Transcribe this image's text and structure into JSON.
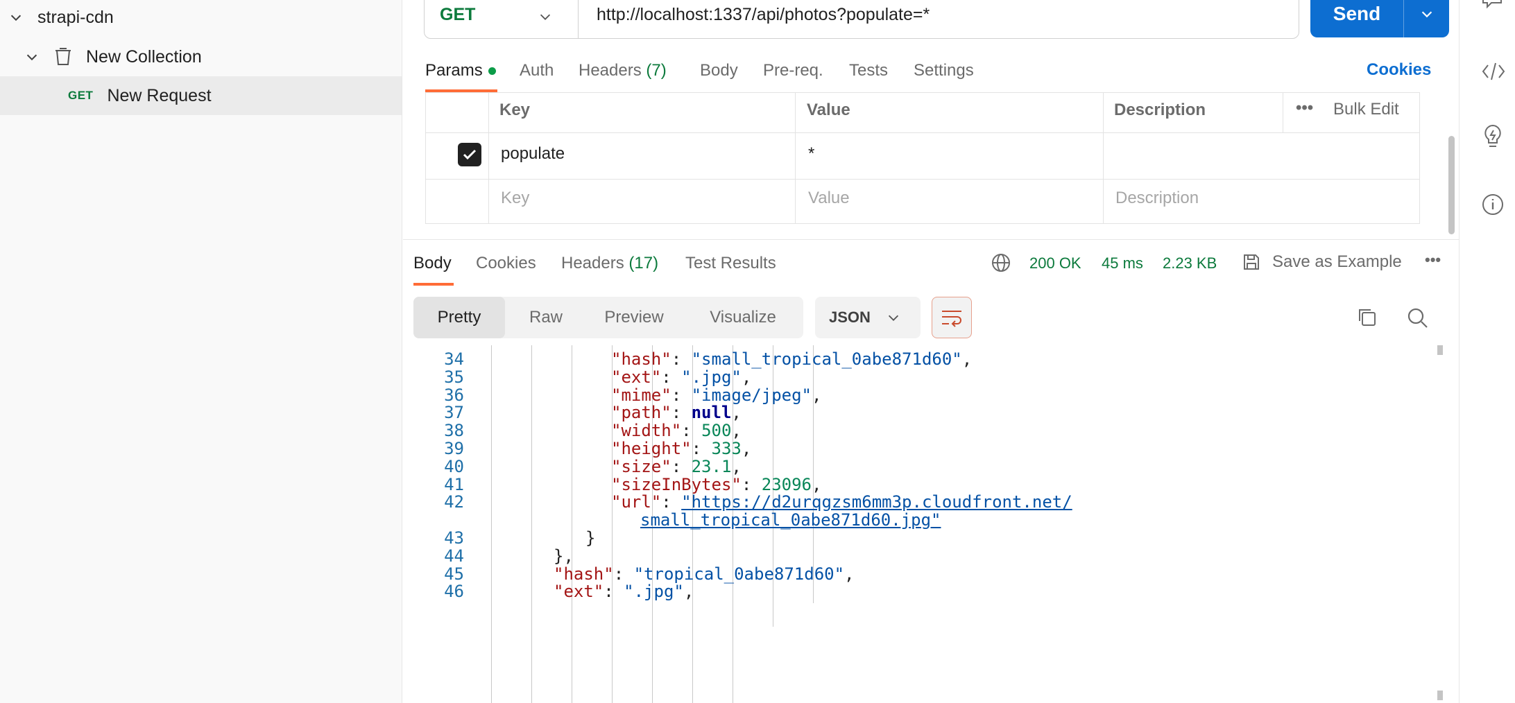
{
  "sidebar": {
    "workspace": "strapi-cdn",
    "collection": "New Collection",
    "request": {
      "method": "GET",
      "name": "New Request"
    }
  },
  "request": {
    "method": "GET",
    "url": "http://localhost:1337/api/photos?populate=*",
    "send_label": "Send"
  },
  "tabs": {
    "params": "Params",
    "auth": "Auth",
    "headers": "Headers",
    "headers_count": "(7)",
    "body": "Body",
    "prereq": "Pre-req.",
    "tests": "Tests",
    "settings": "Settings",
    "cookies": "Cookies"
  },
  "params_table": {
    "col_key": "Key",
    "col_value": "Value",
    "col_description": "Description",
    "bulk_edit": "Bulk Edit",
    "rows": [
      {
        "key": "populate",
        "value": "*",
        "checked": true
      }
    ],
    "placeholder_key": "Key",
    "placeholder_value": "Value",
    "placeholder_description": "Description"
  },
  "response": {
    "tabs": {
      "body": "Body",
      "cookies": "Cookies",
      "headers": "Headers",
      "headers_count": "(17)",
      "test_results": "Test Results"
    },
    "status": "200 OK",
    "time": "45 ms",
    "size": "2.23 KB",
    "save_example": "Save as Example",
    "views": {
      "pretty": "Pretty",
      "raw": "Raw",
      "preview": "Preview",
      "visualize": "Visualize"
    },
    "format": "JSON"
  },
  "code": {
    "line_numbers": [
      "34",
      "35",
      "36",
      "37",
      "38",
      "39",
      "40",
      "41",
      "42",
      "",
      "43",
      "44",
      "45",
      "46"
    ],
    "lines": [
      {
        "key": "\"hash\"",
        "sep": ": ",
        "val": "\"small_tropical_0abe871d60\"",
        "type": "s",
        "end": ","
      },
      {
        "key": "\"ext\"",
        "sep": ": ",
        "val": "\".jpg\"",
        "type": "s",
        "end": ","
      },
      {
        "key": "\"mime\"",
        "sep": ": ",
        "val": "\"image/jpeg\"",
        "type": "s",
        "end": ","
      },
      {
        "key": "\"path\"",
        "sep": ": ",
        "val": "null",
        "type": "b",
        "end": ","
      },
      {
        "key": "\"width\"",
        "sep": ": ",
        "val": "500",
        "type": "n",
        "end": ","
      },
      {
        "key": "\"height\"",
        "sep": ": ",
        "val": "333",
        "type": "n",
        "end": ","
      },
      {
        "key": "\"size\"",
        "sep": ": ",
        "val": "23.1",
        "type": "n",
        "end": ","
      },
      {
        "key": "\"sizeInBytes\"",
        "sep": ": ",
        "val": "23096",
        "type": "n",
        "end": ","
      },
      {
        "key": "\"url\"",
        "sep": ": ",
        "val": "\"https://d2urqgzsm6mm3p.cloudfront.net/",
        "type": "s",
        "end": ""
      },
      {
        "key": "",
        "sep": "",
        "val": "small_tropical_0abe871d60.jpg\"",
        "type": "s",
        "end": ""
      },
      {
        "key": "",
        "sep": "",
        "val": "}",
        "type": "p",
        "end": ""
      },
      {
        "key": "",
        "sep": "",
        "val": "},",
        "type": "p",
        "end": ""
      },
      {
        "key": "\"hash\"",
        "sep": ": ",
        "val": "\"tropical_0abe871d60\"",
        "type": "s",
        "end": ","
      },
      {
        "key": "\"ext\"",
        "sep": ": ",
        "val": "\".jpg\"",
        "type": "s",
        "end": ","
      }
    ]
  },
  "colors": {
    "accent": "#0d6ed1",
    "tab_underline": "#ff6c37",
    "success": "#0c7a3c"
  }
}
